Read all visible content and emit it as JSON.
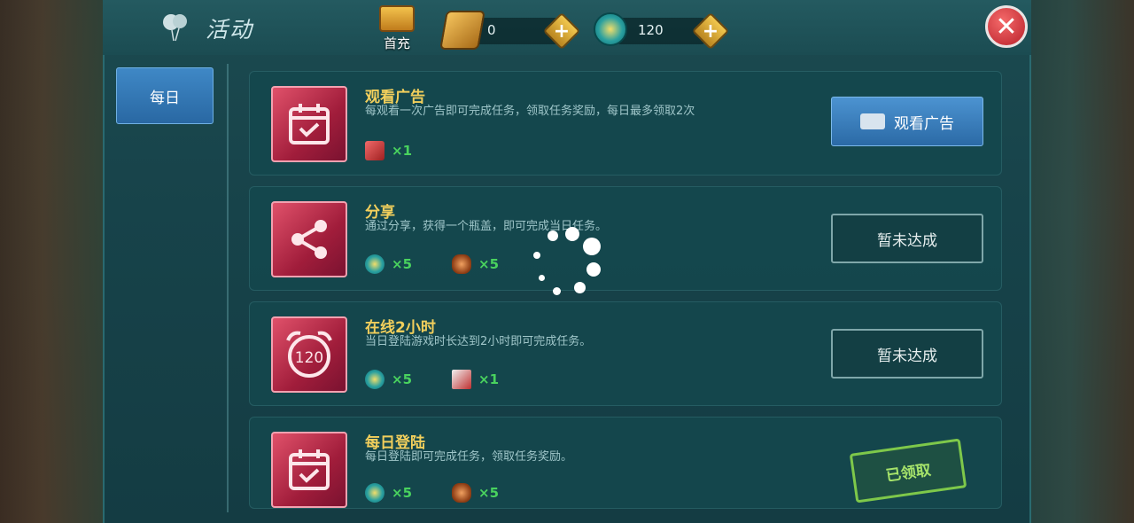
{
  "header": {
    "title": "活动",
    "first_charge_label": "首充",
    "gem_value": "0",
    "coin_value": "120"
  },
  "sidebar": {
    "tabs": [
      {
        "label": "每日",
        "selected": true
      }
    ]
  },
  "tasks": [
    {
      "title": "观看广告",
      "desc": "每观看一次广告即可完成任务，领取任务奖励，每日最多领取2次",
      "rewards": [
        {
          "icon": "gift-box-icon",
          "count": "×1"
        }
      ],
      "action": "观看广告",
      "state": "available"
    },
    {
      "title": "分享",
      "desc": "通过分享，获得一个瓶盖，即可完成当日任务。",
      "rewards": [
        {
          "icon": "coin-icon",
          "count": "×5"
        },
        {
          "icon": "bottle-cap-icon",
          "count": "×5"
        }
      ],
      "action": "暂未达成",
      "state": "locked"
    },
    {
      "title": "在线2小时",
      "desc": "当日登陆游戏时长达到2小时即可完成任务。",
      "rewards": [
        {
          "icon": "coin-icon",
          "count": "×5"
        },
        {
          "icon": "megaphone-icon",
          "count": "×1"
        }
      ],
      "action": "暂未达成",
      "state": "locked"
    },
    {
      "title": "每日登陆",
      "desc": "每日登陆即可完成任务，领取任务奖励。",
      "rewards": [
        {
          "icon": "coin-icon",
          "count": "×5"
        },
        {
          "icon": "bottle-cap-icon",
          "count": "×5"
        }
      ],
      "action": "已领取",
      "state": "claimed"
    }
  ],
  "icons": {
    "close": "close-icon",
    "title": "balloon-icon",
    "card_1": "calendar-check-icon",
    "card_2": "share-icon",
    "card_3": "alarm-clock-120-icon",
    "card_4": "calendar-check-icon"
  },
  "colors": {
    "task_title": "#f2cf5c",
    "reward_count": "#49d25e",
    "primary_button": "#3f88c6",
    "claimed_stamp": "#7ec84a"
  },
  "loading": true
}
